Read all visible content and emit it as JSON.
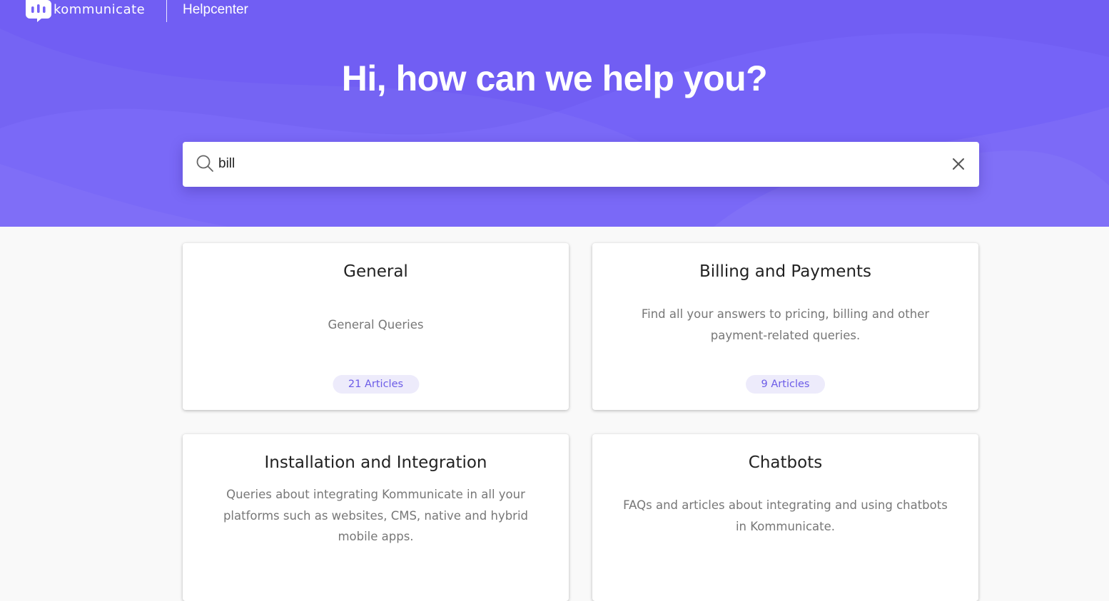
{
  "header": {
    "brand_name": "kommunicate",
    "brand_logo_icon": "chat-bubble-logo-icon",
    "helpcenter_label": "Helpcenter"
  },
  "hero": {
    "title": "Hi, how can we help you?",
    "background_color": "#7563f7"
  },
  "search": {
    "value": "bill",
    "search_icon": "search-icon",
    "clear_icon": "close-icon"
  },
  "categories": [
    {
      "title": "General",
      "description": "General Queries",
      "articles": "21 Articles"
    },
    {
      "title": "Billing and Payments",
      "description": "Find all your answers to pricing, billing and other payment-related queries.",
      "articles": "9 Articles"
    },
    {
      "title": "Installation and Integration",
      "description": "Queries about integrating Kommunicate in all your platforms such as websites, CMS, native and hybrid mobile apps."
    },
    {
      "title": "Chatbots",
      "description": "FAQs and articles about integrating and using chatbots in Kommunicate."
    }
  ],
  "colors": {
    "accent": "#7563f7",
    "badge_background": "#edebfb",
    "badge_text": "#6c5ce7",
    "page_background": "#f9f9f9"
  }
}
